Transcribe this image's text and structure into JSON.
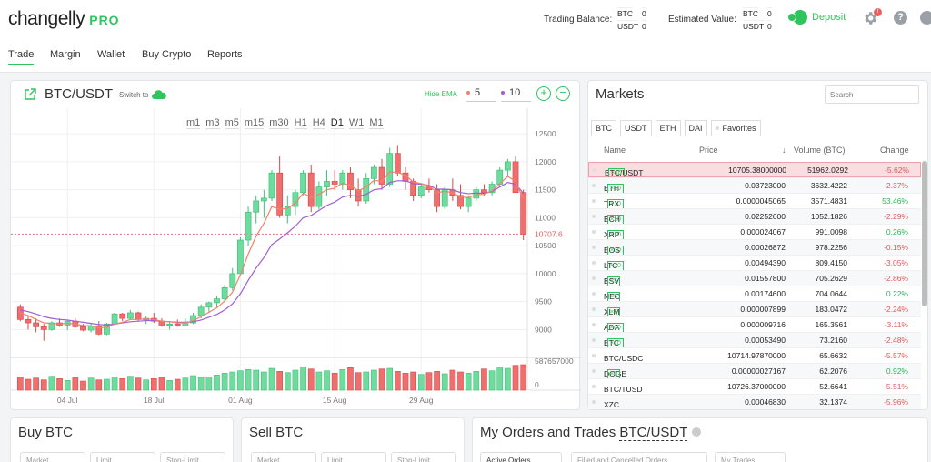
{
  "logo": {
    "name": "changelly",
    "pro": "PRO"
  },
  "balances": {
    "trading_label": "Trading Balance:",
    "trading": [
      {
        "cur": "BTC",
        "val": "0"
      },
      {
        "cur": "USDT",
        "val": "0"
      }
    ],
    "est_label": "Estimated Value:",
    "est": [
      {
        "cur": "BTC",
        "val": "0"
      },
      {
        "cur": "USDT",
        "val": "0"
      }
    ]
  },
  "deposit_label": "Deposit",
  "notif_count": "!",
  "help_label": "?",
  "nav": [
    "Trade",
    "Margin",
    "Wallet",
    "Buy Crypto",
    "Reports"
  ],
  "chartpanel": {
    "pair": "BTC/USDT",
    "switch_label": "Switch to",
    "hide_ema": "Hide EMA",
    "ema1": "5",
    "ema2": "10",
    "ema1_color": "#f0826b",
    "ema2_color": "#a05fd0",
    "plus": "+",
    "minus": "−",
    "timeframes": [
      "m1",
      "m3",
      "m5",
      "m15",
      "m30",
      "H1",
      "H4",
      "D1",
      "W1",
      "M1"
    ],
    "selected_tf": "D1"
  },
  "chart_data": {
    "type": "candlestick",
    "up_color": "#6fdc9e",
    "down_color": "#ef6f6f",
    "ylim": [
      8600,
      12600
    ],
    "yticks": [
      "12500",
      "12000",
      "11500",
      "11000",
      "10500",
      "10000",
      "9500",
      "9000"
    ],
    "last_price": "10707.6",
    "volume_tick_top": "587657000",
    "volume_tick_bottom": "0",
    "volume_max": 587657000,
    "xticks": [
      {
        "i": 6,
        "label": "04 Jul"
      },
      {
        "i": 17,
        "label": "18 Jul"
      },
      {
        "i": 28,
        "label": "01 Aug"
      },
      {
        "i": 40,
        "label": "15 Aug"
      },
      {
        "i": 51,
        "label": "29 Aug"
      }
    ],
    "candles": [
      [
        9400,
        9450,
        9150,
        9180
      ],
      [
        9180,
        9250,
        9000,
        9120
      ],
      [
        9120,
        9200,
        8950,
        9050
      ],
      [
        9050,
        9100,
        8800,
        9000
      ],
      [
        9000,
        9150,
        8980,
        9120
      ],
      [
        9120,
        9200,
        9050,
        9080
      ],
      [
        9080,
        9180,
        8990,
        9150
      ],
      [
        9150,
        9200,
        9030,
        9050
      ],
      [
        9050,
        9100,
        8970,
        8990
      ],
      [
        8990,
        9100,
        8950,
        9060
      ],
      [
        9060,
        9150,
        8900,
        8920
      ],
      [
        8920,
        9120,
        8900,
        9100
      ],
      [
        9100,
        9300,
        9080,
        9280
      ],
      [
        9280,
        9300,
        9150,
        9200
      ],
      [
        9200,
        9350,
        9180,
        9300
      ],
      [
        9300,
        9320,
        9150,
        9180
      ],
      [
        9180,
        9250,
        9100,
        9200
      ],
      [
        9200,
        9300,
        9120,
        9150
      ],
      [
        9150,
        9200,
        9050,
        9080
      ],
      [
        9080,
        9150,
        9000,
        9100
      ],
      [
        9100,
        9180,
        9050,
        9070
      ],
      [
        9070,
        9200,
        9050,
        9120
      ],
      [
        9120,
        9300,
        9100,
        9250
      ],
      [
        9250,
        9450,
        9200,
        9400
      ],
      [
        9400,
        9500,
        9300,
        9480
      ],
      [
        9480,
        9600,
        9400,
        9550
      ],
      [
        9550,
        9800,
        9500,
        9750
      ],
      [
        9750,
        10100,
        9700,
        10000
      ],
      [
        10000,
        10650,
        9950,
        10600
      ],
      [
        10600,
        11200,
        10500,
        11100
      ],
      [
        11100,
        11400,
        10900,
        11300
      ],
      [
        11300,
        11500,
        11000,
        11350
      ],
      [
        11350,
        11850,
        11300,
        11800
      ],
      [
        11800,
        12100,
        11000,
        11050
      ],
      [
        11050,
        11400,
        10900,
        11200
      ],
      [
        11200,
        11500,
        11050,
        11450
      ],
      [
        11450,
        11850,
        11400,
        11800
      ],
      [
        11800,
        11950,
        11100,
        11200
      ],
      [
        11200,
        11650,
        11150,
        11550
      ],
      [
        11550,
        11850,
        11400,
        11650
      ],
      [
        11650,
        11850,
        11500,
        11600
      ],
      [
        11600,
        11850,
        11500,
        11800
      ],
      [
        11800,
        11900,
        11350,
        11500
      ],
      [
        11500,
        11700,
        11200,
        11300
      ],
      [
        11300,
        11800,
        11250,
        11700
      ],
      [
        11700,
        11950,
        11600,
        11900
      ],
      [
        11900,
        12050,
        11500,
        11600
      ],
      [
        11600,
        12250,
        11550,
        12150
      ],
      [
        12150,
        12300,
        11750,
        11800
      ],
      [
        11800,
        11900,
        11500,
        11650
      ],
      [
        11650,
        11700,
        11300,
        11400
      ],
      [
        11400,
        11600,
        11350,
        11550
      ],
      [
        11550,
        11700,
        11450,
        11500
      ],
      [
        11500,
        11600,
        11100,
        11200
      ],
      [
        11200,
        11550,
        11150,
        11500
      ],
      [
        11500,
        11700,
        11300,
        11400
      ],
      [
        11400,
        11600,
        11150,
        11200
      ],
      [
        11200,
        11400,
        11100,
        11350
      ],
      [
        11350,
        11550,
        11300,
        11500
      ],
      [
        11500,
        11600,
        11400,
        11450
      ],
      [
        11450,
        11650,
        11400,
        11600
      ],
      [
        11600,
        11900,
        11550,
        11850
      ],
      [
        11850,
        12050,
        11750,
        12000
      ],
      [
        12000,
        12100,
        11700,
        11450
      ],
      [
        11450,
        11500,
        10600,
        10707.6
      ]
    ],
    "volumes": [
      220,
      180,
      200,
      170,
      230,
      190,
      160,
      210,
      150,
      200,
      170,
      180,
      220,
      190,
      230,
      200,
      170,
      190,
      210,
      160,
      180,
      200,
      240,
      210,
      220,
      250,
      280,
      300,
      320,
      340,
      330,
      300,
      360,
      310,
      290,
      330,
      380,
      350,
      300,
      320,
      280,
      340,
      370,
      290,
      300,
      330,
      350,
      360,
      310,
      280,
      300,
      260,
      290,
      310,
      270,
      330,
      300,
      280,
      310,
      350,
      320,
      380,
      360,
      410,
      420
    ],
    "ema5": [
      9300,
      9250,
      9180,
      9120,
      9110,
      9100,
      9110,
      9100,
      9070,
      9070,
      9030,
      9040,
      9100,
      9130,
      9180,
      9180,
      9190,
      9180,
      9150,
      9140,
      9120,
      9120,
      9160,
      9230,
      9310,
      9390,
      9510,
      9670,
      9980,
      10350,
      10670,
      10900,
      11200,
      11150,
      11170,
      11260,
      11440,
      11360,
      11420,
      11500,
      11530,
      11620,
      11580,
      11480,
      11550,
      11670,
      11650,
      11820,
      11810,
      11760,
      11640,
      11610,
      11570,
      11450,
      11470,
      11450,
      11370,
      11360,
      11410,
      11420,
      11480,
      11610,
      11740,
      11650,
      11330
    ],
    "ema10": [
      9350,
      9320,
      9280,
      9230,
      9200,
      9180,
      9170,
      9150,
      9130,
      9110,
      9090,
      9080,
      9100,
      9120,
      9140,
      9150,
      9160,
      9160,
      9150,
      9140,
      9130,
      9130,
      9140,
      9170,
      9220,
      9270,
      9350,
      9460,
      9640,
      9880,
      10100,
      10290,
      10520,
      10620,
      10730,
      10850,
      11000,
      11040,
      11130,
      11220,
      11280,
      11370,
      11400,
      11380,
      11420,
      11500,
      11520,
      11630,
      11660,
      11660,
      11610,
      11600,
      11580,
      11510,
      11510,
      11500,
      11450,
      11430,
      11440,
      11440,
      11470,
      11550,
      11630,
      11600,
      11440
    ]
  },
  "markets": {
    "title": "Markets",
    "search_placeholder": "Search",
    "tabs": [
      "BTC",
      "USDT",
      "ETH",
      "DAI",
      "Favorites"
    ],
    "headers": {
      "name": "Name",
      "price": "Price",
      "volume": "Volume (BTC)",
      "change": "Change"
    },
    "rows": [
      {
        "pair": "BTC/USDT",
        "mult": "×10",
        "price": "10705.38000000",
        "vol": "51962.0292",
        "chg": "-5.62%",
        "dir": "neg",
        "sel": true
      },
      {
        "pair": "ETH",
        "mult": "×10",
        "price": "0.03723000",
        "vol": "3632.4222",
        "chg": "-2.37%",
        "dir": "neg"
      },
      {
        "pair": "TRX",
        "mult": "×10",
        "price": "0.0000045065",
        "vol": "3571.4831",
        "chg": "53.46%",
        "dir": "pos"
      },
      {
        "pair": "BCH",
        "mult": "×10",
        "price": "0.02252600",
        "vol": "1052.1826",
        "chg": "-2.29%",
        "dir": "neg"
      },
      {
        "pair": "XRP",
        "mult": "×10",
        "price": "0.000024067",
        "vol": "991.0098",
        "chg": "0.26%",
        "dir": "pos"
      },
      {
        "pair": "EOS",
        "mult": "×10",
        "price": "0.00026872",
        "vol": "978.2256",
        "chg": "-0.15%",
        "dir": "neg"
      },
      {
        "pair": "LTC",
        "mult": "×10",
        "price": "0.00494390",
        "vol": "809.4150",
        "chg": "-3.05%",
        "dir": "neg"
      },
      {
        "pair": "BSV",
        "mult": "×5",
        "price": "0.01557800",
        "vol": "705.2629",
        "chg": "-2.86%",
        "dir": "neg"
      },
      {
        "pair": "NEO",
        "mult": "×5",
        "price": "0.00174600",
        "vol": "704.0644",
        "chg": "0.22%",
        "dir": "pos"
      },
      {
        "pair": "XLM",
        "mult": "×5",
        "price": "0.000007899",
        "vol": "183.0472",
        "chg": "-2.24%",
        "dir": "neg"
      },
      {
        "pair": "ADA",
        "mult": "×10",
        "price": "0.000009716",
        "vol": "165.3561",
        "chg": "-3.11%",
        "dir": "neg"
      },
      {
        "pair": "ETC",
        "mult": "×10",
        "price": "0.00053490",
        "vol": "73.2160",
        "chg": "-2.48%",
        "dir": "neg"
      },
      {
        "pair": "BTC/USDC",
        "mult": "",
        "price": "10714.97870000",
        "vol": "65.6632",
        "chg": "-5.57%",
        "dir": "neg"
      },
      {
        "pair": "DOGE",
        "mult": "×5",
        "price": "0.00000027167",
        "vol": "62.2076",
        "chg": "0.92%",
        "dir": "pos"
      },
      {
        "pair": "BTC/TUSD",
        "mult": "",
        "price": "10726.37000000",
        "vol": "52.6641",
        "chg": "-5.51%",
        "dir": "neg"
      },
      {
        "pair": "XZC",
        "mult": "",
        "price": "0.00046830",
        "vol": "32.1374",
        "chg": "-5.96%",
        "dir": "neg"
      }
    ]
  },
  "buy": {
    "title": "Buy BTC",
    "tabs": [
      "Market",
      "Limit",
      "Stop-Limit"
    ]
  },
  "sell": {
    "title": "Sell BTC",
    "tabs": [
      "Market",
      "Limit",
      "Stop-Limit"
    ]
  },
  "orders": {
    "title_prefix": "My Orders and Trades",
    "title_pair": "BTC/USDT",
    "tabs": [
      "Active Orders",
      "Filled and Cancelled Orders",
      "My Trades"
    ]
  }
}
